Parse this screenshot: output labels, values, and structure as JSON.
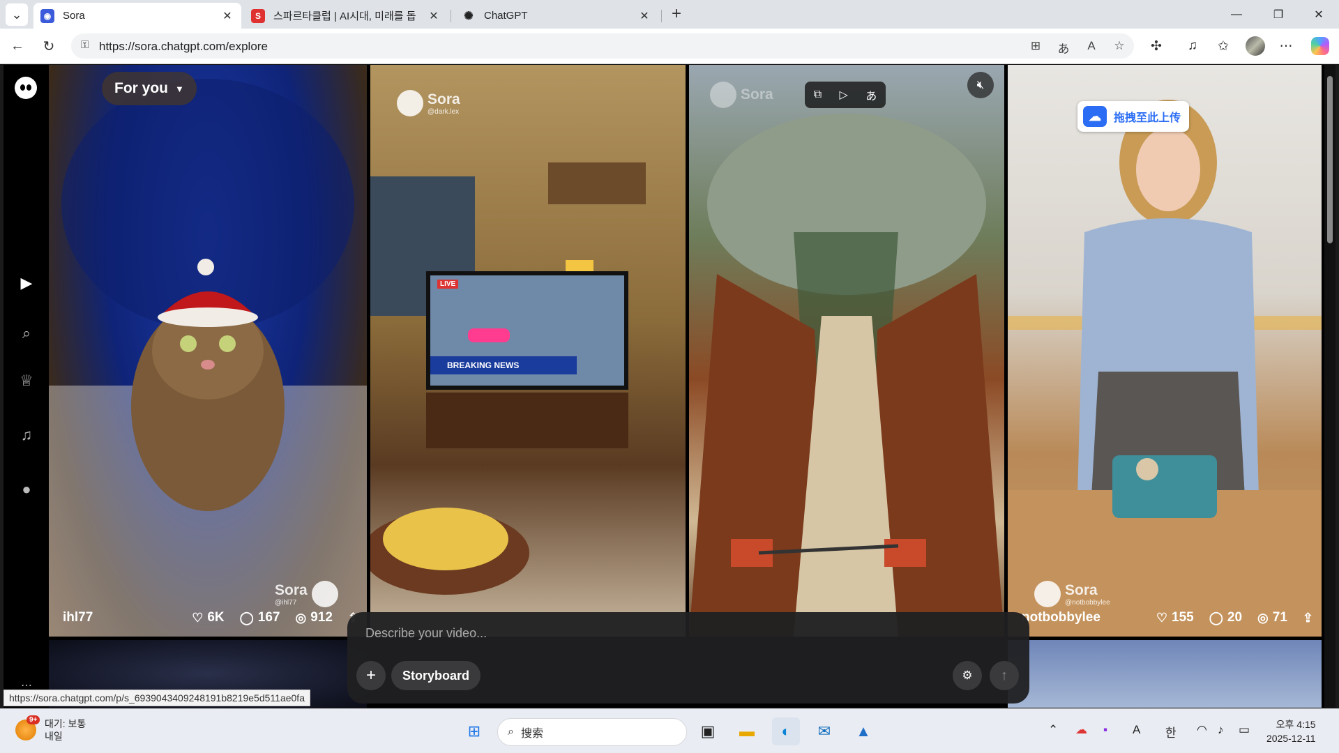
{
  "browser": {
    "tabs": [
      {
        "title": "Sora",
        "active": true
      },
      {
        "title": "스파르타클럽 | AI시대, 미래를 돕",
        "active": false
      },
      {
        "title": "ChatGPT",
        "active": false
      }
    ],
    "url": "https://sora.chatgpt.com/explore",
    "status_url": "https://sora.chatgpt.com/p/s_6939043409248191b8219e5d511ae0fa"
  },
  "feed": {
    "filter_label": "For you",
    "upload_badge": "拖拽至此上传",
    "tiles": [
      {
        "user": "ihl77",
        "likes": "6K",
        "comments": "167",
        "remixes": "912",
        "watermark_handle": "@ihl77"
      },
      {
        "user": "",
        "watermark_handle": "@dark.lex"
      },
      {
        "user": "",
        "watermark_handle": ""
      },
      {
        "user": "notbobbylee",
        "likes": "155",
        "comments": "20",
        "remixes": "71",
        "watermark_handle": "@notbobbylee"
      }
    ],
    "watermark_brand": "Sora",
    "tv_live": "LIVE",
    "tv_breaking": "BREAKING NEWS"
  },
  "prompt": {
    "placeholder": "Describe your video...",
    "storyboard_label": "Storyboard"
  },
  "taskbar": {
    "weather_title": "대기: 보통",
    "weather_sub": "내일",
    "weather_badge": "9+",
    "search_placeholder": "搜索",
    "ime_a": "A",
    "ime_han": "한",
    "time": "오후 4:15",
    "date": "2025-12-11"
  },
  "icons": {
    "tab_menu": "chevron-down-icon",
    "back": "back-arrow-icon",
    "refresh": "refresh-icon",
    "rail": [
      "home-icon",
      "search-icon",
      "trophy-icon",
      "bell-icon",
      "profile-icon"
    ]
  }
}
